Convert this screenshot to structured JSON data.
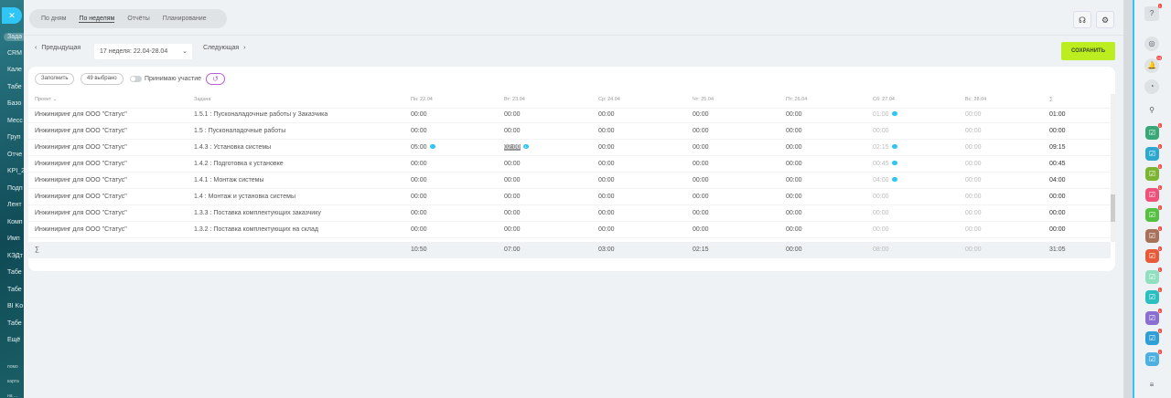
{
  "leftnav": {
    "items": [
      "Зада",
      "CRM",
      "Кале",
      "Табе",
      "Базо",
      "Месс",
      "Груп",
      "Отче",
      "KPI_2",
      "Подп",
      "Лент",
      "Комп",
      "Имп",
      "КЭДт",
      "Табе",
      "Табе",
      "BI Ko",
      "Табе",
      "Ещё"
    ],
    "small": [
      "помо",
      "карта",
      "на ..."
    ]
  },
  "tabs": [
    "По дням",
    "По неделям",
    "Отчёты",
    "Планирование"
  ],
  "nav": {
    "prev": "Предыдущая",
    "week": "17 неделя: 22.04-28.04",
    "next": "Следующая",
    "save": "СОХРАНИТЬ"
  },
  "toolbar": {
    "fill": "Заполнить",
    "selected": "49 выбрано",
    "participate": "Принимаю участие"
  },
  "table": {
    "headers": [
      "Проект",
      "Задача",
      "Пн: 22.04",
      "Вт: 23.04",
      "Ср: 24.04",
      "Чт: 25.04",
      "Пт: 26.04",
      "Сб: 27.04",
      "Вс: 28.04",
      "∑"
    ],
    "rows": [
      {
        "project": "Инжиниринг для ООО \"Статус\"",
        "task": "1.5.1 : Пусконаладочные работы у Заказчика",
        "days": [
          "00:00",
          "00:00",
          "00:00",
          "00:00",
          "00:00",
          "01:00",
          "00:00"
        ],
        "total": "01:00"
      },
      {
        "project": "Инжиниринг для ООО \"Статус\"",
        "task": "1.5 : Пусконаладочные работы",
        "days": [
          "00:00",
          "00:00",
          "00:00",
          "00:00",
          "00:00",
          "00:00",
          "00:00"
        ],
        "total": "00:00"
      },
      {
        "project": "Инжиниринг для ООО \"Статус\"",
        "task": "1.4.3 : Установка системы",
        "days": [
          "05:00",
          "02:00",
          "00:00",
          "00:00",
          "00:00",
          "02:15",
          "00:00"
        ],
        "total": "09:15"
      },
      {
        "project": "Инжиниринг для ООО \"Статус\"",
        "task": "1.4.2 : Подготовка к установке",
        "days": [
          "00:00",
          "00:00",
          "00:00",
          "00:00",
          "00:00",
          "00:45",
          "00:00"
        ],
        "total": "00:45"
      },
      {
        "project": "Инжиниринг для ООО \"Статус\"",
        "task": "1.4.1 : Монтаж системы",
        "days": [
          "00:00",
          "00:00",
          "00:00",
          "00:00",
          "00:00",
          "04:00",
          "00:00"
        ],
        "total": "04:00"
      },
      {
        "project": "Инжиниринг для ООО \"Статус\"",
        "task": "1.4 : Монтаж и установка системы",
        "days": [
          "00:00",
          "00:00",
          "00:00",
          "00:00",
          "00:00",
          "00:00",
          "00:00"
        ],
        "total": "00:00"
      },
      {
        "project": "Инжиниринг для ООО \"Статус\"",
        "task": "1.3.3 : Поставка комплектующих заказчику",
        "days": [
          "00:00",
          "00:00",
          "00:00",
          "00:00",
          "00:00",
          "00:00",
          "00:00"
        ],
        "total": "00:00"
      },
      {
        "project": "Инжиниринг для ООО \"Статус\"",
        "task": "1.3.2 : Поставка комплектующих на склад",
        "days": [
          "00:00",
          "00:00",
          "00:00",
          "00:00",
          "00:00",
          "00:00",
          "00:00"
        ],
        "total": "00:00"
      }
    ],
    "sum": {
      "label": "∑",
      "days": [
        "10:50",
        "07:00",
        "03:00",
        "02:15",
        "00:00",
        "08:00",
        "00:00"
      ],
      "total": "31:05"
    }
  },
  "rightbar": {
    "help_badge": "1",
    "notif_badge": "33",
    "comment_badge": "1",
    "app_colors": [
      "#3aa876",
      "#2fa8d0",
      "#7bb532",
      "#f0517a",
      "#55c041",
      "#a8725a",
      "#e85b3a",
      "#8fdfc0",
      "#2bbfc0",
      "#8a6fd0",
      "#2f9fd6",
      "#4db0e0"
    ]
  }
}
